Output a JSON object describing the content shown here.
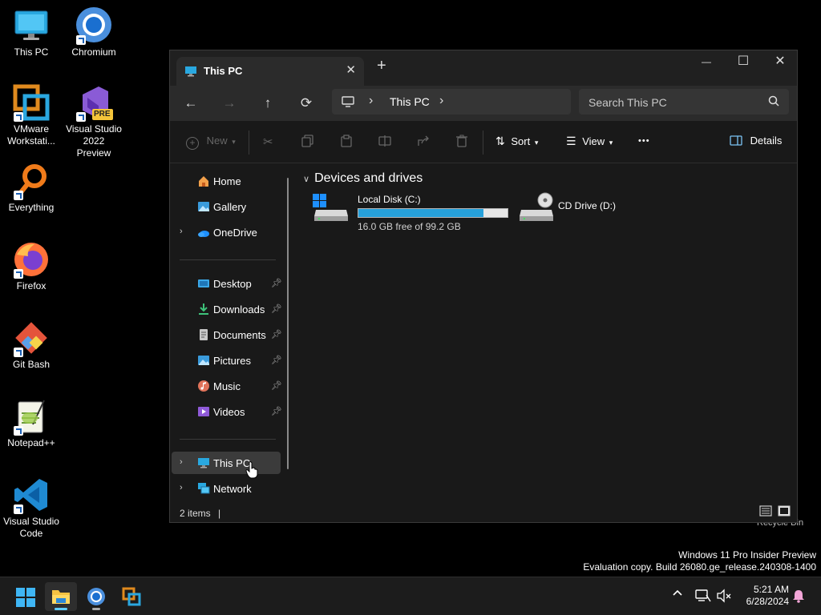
{
  "desktop": {
    "icons": [
      {
        "label": "This PC"
      },
      {
        "label": "Chromium"
      },
      {
        "label": "VMware Workstati..."
      },
      {
        "label": "Visual Studio 2022 Preview",
        "badge": "PRE"
      },
      {
        "label": "Everything"
      },
      {
        "label": "Firefox"
      },
      {
        "label": "Git Bash"
      },
      {
        "label": "Notepad++"
      },
      {
        "label": "Visual Studio Code"
      }
    ],
    "recycle_label": "Recycle Bin",
    "watermark_line1": "Windows 11 Pro Insider Preview",
    "watermark_line2": "Evaluation copy. Build 26080.ge_release.240308-1400"
  },
  "window": {
    "tab_title": "This PC",
    "new_tab": "+",
    "close_tab": "✕",
    "minimize": "—",
    "maximize": "☐",
    "close": "✕",
    "nav": {
      "back": "←",
      "forward": "→",
      "up": "↑",
      "refresh": "⟳"
    },
    "address": {
      "crumb": "This PC",
      "sep": "›"
    },
    "search": {
      "placeholder": "Search This PC"
    },
    "commands": {
      "new_label": "New",
      "sort_label": "Sort",
      "view_label": "View",
      "more": "•••",
      "details_label": "Details"
    },
    "sidebar": {
      "items": [
        {
          "label": "Home"
        },
        {
          "label": "Gallery"
        },
        {
          "label": "OneDrive"
        },
        {
          "label": "Desktop"
        },
        {
          "label": "Downloads"
        },
        {
          "label": "Documents"
        },
        {
          "label": "Pictures"
        },
        {
          "label": "Music"
        },
        {
          "label": "Videos"
        },
        {
          "label": "This PC"
        },
        {
          "label": "Network"
        }
      ]
    },
    "content": {
      "group_header": "Devices and drives",
      "drives": [
        {
          "name": "Local Disk (C:)",
          "free_text": "16.0 GB free of 99.2 GB",
          "used_fraction": 0.839
        },
        {
          "name": "CD Drive (D:)"
        }
      ]
    },
    "status": {
      "items_count": "2 items"
    }
  },
  "taskbar": {
    "clock_time": "5:21 AM",
    "clock_date": "6/28/2024"
  },
  "colors": {
    "accent": "#26a0da",
    "taskbar_indicator": "#60cdff"
  }
}
